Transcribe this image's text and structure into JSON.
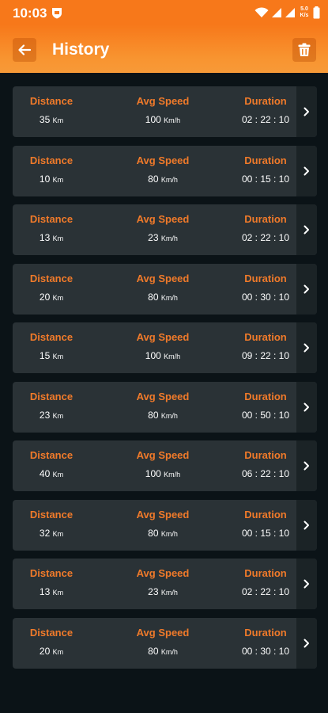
{
  "status": {
    "time": "10:03",
    "speed_top": "5.0",
    "speed_bottom": "K/s"
  },
  "header": {
    "title": "History"
  },
  "labels": {
    "distance": "Distance",
    "avg_speed": "Avg Speed",
    "duration": "Duration"
  },
  "rows": [
    {
      "distance": "35",
      "distance_unit": "Km",
      "speed": "100",
      "speed_unit": "Km/h",
      "duration": "02 : 22 : 10"
    },
    {
      "distance": "10",
      "distance_unit": "Km",
      "speed": "80",
      "speed_unit": "Km/h",
      "duration": "00 : 15 : 10"
    },
    {
      "distance": "13",
      "distance_unit": "Km",
      "speed": "23",
      "speed_unit": "Km/h",
      "duration": "02 : 22 : 10"
    },
    {
      "distance": "20",
      "distance_unit": "Km",
      "speed": "80",
      "speed_unit": "Km/h",
      "duration": "00 : 30 : 10"
    },
    {
      "distance": "15",
      "distance_unit": "Km",
      "speed": "100",
      "speed_unit": "Km/h",
      "duration": "09 : 22 : 10"
    },
    {
      "distance": "23",
      "distance_unit": "Km",
      "speed": "80",
      "speed_unit": "Km/h",
      "duration": "00 : 50 : 10"
    },
    {
      "distance": "40",
      "distance_unit": "Km",
      "speed": "100",
      "speed_unit": "Km/h",
      "duration": "06 : 22 : 10"
    },
    {
      "distance": "32",
      "distance_unit": "Km",
      "speed": "80",
      "speed_unit": "Km/h",
      "duration": "00 : 15 : 10"
    },
    {
      "distance": "13",
      "distance_unit": "Km",
      "speed": "23",
      "speed_unit": "Km/h",
      "duration": "02 : 22 : 10"
    },
    {
      "distance": "20",
      "distance_unit": "Km",
      "speed": "80",
      "speed_unit": "Km/h",
      "duration": "00 : 30 : 10"
    }
  ],
  "colors": {
    "accent": "#f7781a",
    "label": "#f07a2a",
    "card": "#2a3236",
    "background": "#0b1317"
  },
  "icons": {
    "back": "arrow-left-icon",
    "delete": "trash-icon",
    "row_action": "chevron-right-icon"
  }
}
